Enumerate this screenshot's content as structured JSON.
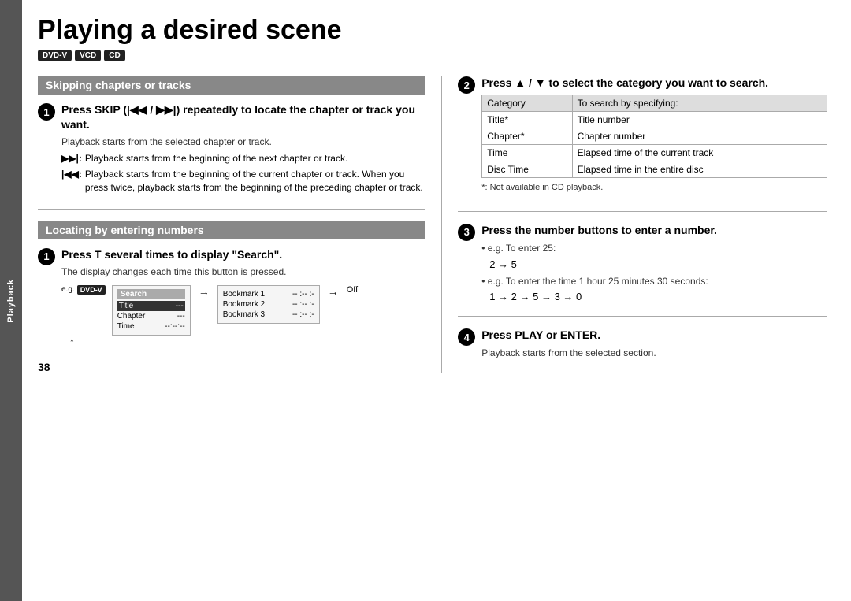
{
  "sidebar": {
    "label": "Playback"
  },
  "page": {
    "title": "Playing a desired scene",
    "number": "38",
    "badges": [
      "DVD-V",
      "VCD",
      "CD"
    ]
  },
  "left_col": {
    "section1": {
      "header": "Skipping chapters or tracks",
      "step": {
        "num": "1",
        "title": "Press SKIP (|◀◀ / ▶▶|) repeatedly to locate the chapter or track you want.",
        "desc": "Playback starts from the selected chapter or track.",
        "bullets": [
          {
            "sym": "▶▶|:",
            "text": "Playback starts from the beginning of the next chapter or track."
          },
          {
            "sym": "|◀◀:",
            "text": "Playback starts from the beginning of the current chapter or track. When you press twice, playback starts from the beginning of the preceding chapter or track."
          }
        ]
      }
    },
    "section2": {
      "header": "Locating by entering numbers",
      "step": {
        "num": "1",
        "title": "Press T several times to display \"Search\".",
        "desc": "The display changes each time this button is pressed.",
        "eg_label": "e.g.",
        "dvd_badge": "DVD-V",
        "screen1": {
          "header": "Search",
          "rows": [
            {
              "label": "Title",
              "value": "---",
              "selected": true
            },
            {
              "label": "Chapter",
              "value": "---",
              "selected": false
            },
            {
              "label": "Time",
              "value": "--:--:--",
              "selected": false
            }
          ]
        },
        "screen2": {
          "rows": [
            {
              "label": "Bookmark 1",
              "value": "-- :-- :-"
            },
            {
              "label": "Bookmark 2",
              "value": "-- :-- :-"
            },
            {
              "label": "Bookmark 3",
              "value": "-- :-- :-"
            }
          ]
        },
        "off_label": "Off"
      }
    }
  },
  "right_col": {
    "step2": {
      "num": "2",
      "title": "Press ▲ / ▼ to select the category you want to search.",
      "table": {
        "headers": [
          "Category",
          "To search by specifying:"
        ],
        "rows": [
          [
            "Title*",
            "Title number"
          ],
          [
            "Chapter*",
            "Chapter number"
          ],
          [
            "Time",
            "Elapsed time of the current track"
          ],
          [
            "Disc Time",
            "Elapsed time in the entire disc"
          ]
        ]
      },
      "footnote": "*: Not available in CD playback."
    },
    "step3": {
      "num": "3",
      "title": "Press the number buttons to enter a number.",
      "bullets": [
        {
          "label": "e.g. To enter 25:",
          "example": "2 → 5"
        },
        {
          "label": "e.g. To enter the time 1 hour 25 minutes 30 seconds:",
          "example": "1 → 2 → 5 → 3 → 0"
        }
      ]
    },
    "step4": {
      "num": "4",
      "title": "Press PLAY or ENTER.",
      "desc": "Playback starts from the selected section."
    }
  }
}
